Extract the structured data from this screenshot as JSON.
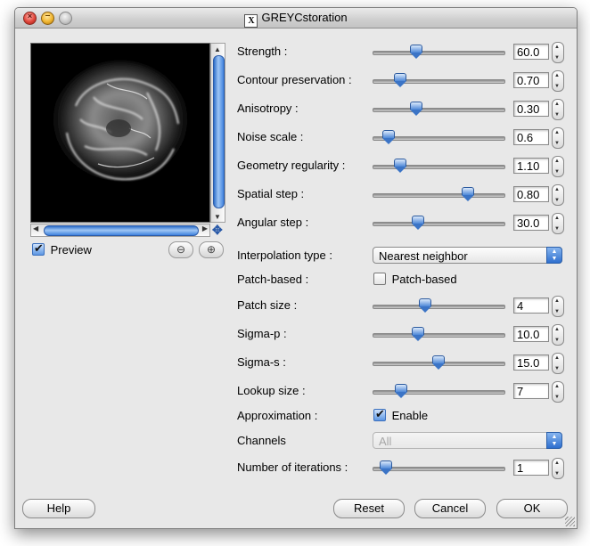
{
  "window": {
    "title": "GREYCstoration",
    "x11_glyph": "X",
    "close_glyph": "×",
    "minimize_glyph": "–"
  },
  "preview": {
    "checkbox_label": "Preview",
    "checked": true,
    "zoom_out_glyph": "⊖",
    "zoom_in_glyph": "⊕",
    "scroll_up": "▲",
    "scroll_down": "▼",
    "scroll_left": "◀",
    "scroll_right": "▶",
    "nav_glyph": "✥"
  },
  "sliders": [
    {
      "label": "Strength :",
      "value": "60.0",
      "position": 0.33
    },
    {
      "label": "Contour preservation :",
      "value": "0.70",
      "position": 0.21
    },
    {
      "label": "Anisotropy :",
      "value": "0.30",
      "position": 0.33
    },
    {
      "label": "Noise scale :",
      "value": "0.6",
      "position": 0.12
    },
    {
      "label": "Geometry regularity :",
      "value": "1.10",
      "position": 0.21
    },
    {
      "label": "Spatial step :",
      "value": "0.80",
      "position": 0.73
    },
    {
      "label": "Angular step :",
      "value": "30.0",
      "position": 0.35
    }
  ],
  "interpolation": {
    "label": "Interpolation type :",
    "value": "Nearest neighbor"
  },
  "patch_based": {
    "label": "Patch-based :",
    "checkbox_label": "Patch-based",
    "checked": false
  },
  "patch_sliders": [
    {
      "label": "Patch size :",
      "value": "4",
      "position": 0.4
    },
    {
      "label": "Sigma-p :",
      "value": "10.0",
      "position": 0.35
    },
    {
      "label": "Sigma-s :",
      "value": "15.0",
      "position": 0.5
    },
    {
      "label": "Lookup size :",
      "value": "7",
      "position": 0.22
    }
  ],
  "approximation": {
    "label": "Approximation :",
    "checkbox_label": "Enable",
    "checked": true
  },
  "channels": {
    "label": "Channels",
    "value": "All"
  },
  "iterations": {
    "label": "Number of iterations :",
    "value": "1",
    "position": 0.1
  },
  "buttons": {
    "help": "Help",
    "reset": "Reset",
    "cancel": "Cancel",
    "ok": "OK"
  },
  "stepper_glyphs": {
    "up": "▲",
    "down": "▼"
  },
  "select_glyphs": {
    "up": "▲",
    "down": "▼"
  },
  "colors": {
    "accent": "#3b74c6",
    "window_bg": "#e8e8e8"
  }
}
